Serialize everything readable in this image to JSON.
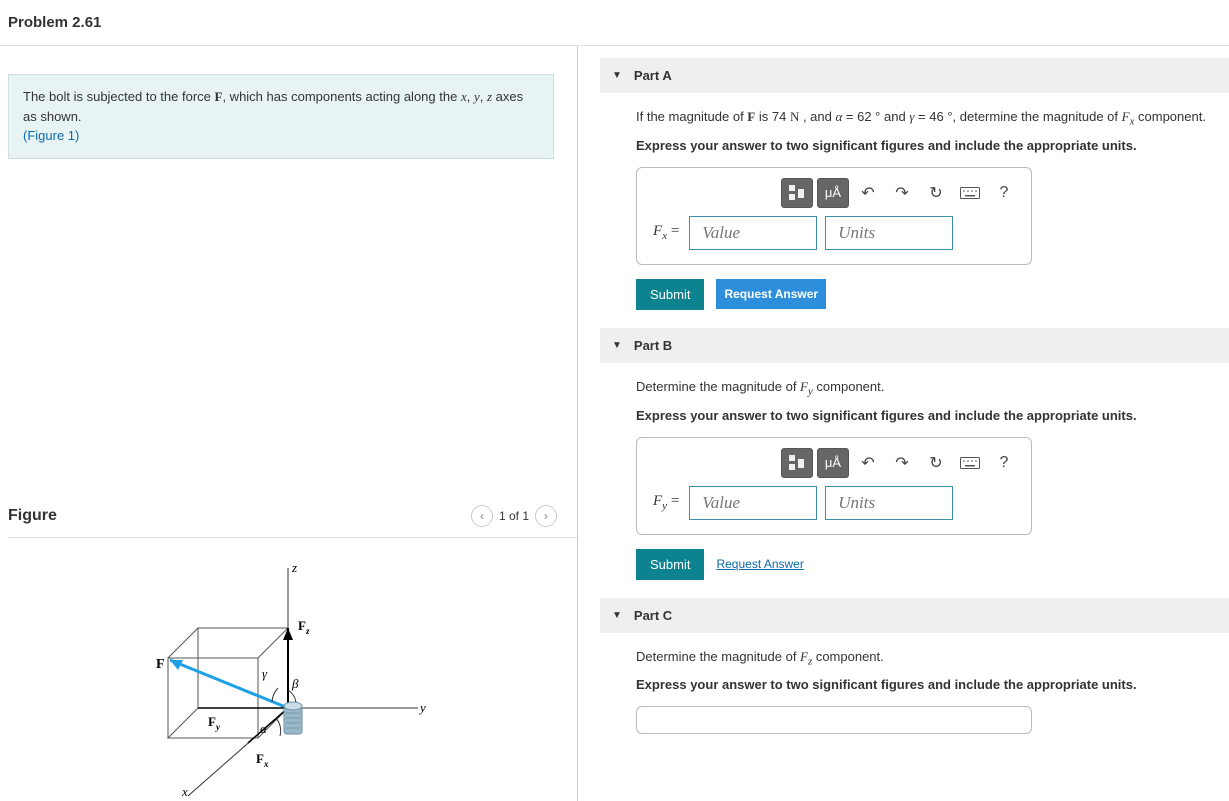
{
  "problem_title": "Problem 2.61",
  "intro": {
    "pre": "The bolt is subjected to the force ",
    "F": "F",
    "mid": ", which has components acting along the ",
    "x": "x",
    "y": "y",
    "z": "z",
    "post": " axes as shown.",
    "fig_link": "(Figure 1)"
  },
  "figure": {
    "heading": "Figure",
    "counter": "1 of 1",
    "labels": {
      "z": "z",
      "y": "y",
      "x": "x",
      "F": "F",
      "Fz": "F",
      "Fzs": "z",
      "Fy": "F",
      "Fys": "y",
      "Fx": "F",
      "Fxs": "x",
      "alpha": "α",
      "beta": "β",
      "gamma": "γ"
    }
  },
  "partA": {
    "title": "Part A",
    "prompt_1a": "If the magnitude of ",
    "prompt_1b": " is 74 ",
    "unitN": "N",
    "prompt_1c": " , and ",
    "alpha": "α",
    "eq62": " = 62 ° ",
    "and": " and ",
    "gamma": "γ",
    "eq46": " = 46 °",
    "prompt_1d": ", determine the magnitude of ",
    "Fx": "F",
    "Fxs": "x",
    "prompt_1e": " component.",
    "bold_instr": "Express your answer to two significant figures and include the appropriate units.",
    "var_label": "F",
    "var_sub": "x",
    "eq_sign": " = ",
    "value_ph": "Value",
    "units_ph": "Units",
    "submit": "Submit",
    "request": "Request Answer",
    "tb_mu": "μÅ",
    "tb_help": "?"
  },
  "partB": {
    "title": "Part B",
    "prompt_1a": "Determine the magnitude of ",
    "Fy": "F",
    "Fys": "y",
    "prompt_1b": " component.",
    "bold_instr": "Express your answer to two significant figures and include the appropriate units.",
    "var_label": "F",
    "var_sub": "y",
    "eq_sign": " = ",
    "value_ph": "Value",
    "units_ph": "Units",
    "submit": "Submit",
    "request": "Request Answer",
    "tb_mu": "μÅ",
    "tb_help": "?"
  },
  "partC": {
    "title": "Part C",
    "prompt_1a": "Determine the magnitude of ",
    "Fz": "F",
    "Fzs": "z",
    "prompt_1b": " component.",
    "bold_instr": "Express your answer to two significant figures and include the appropriate units."
  }
}
